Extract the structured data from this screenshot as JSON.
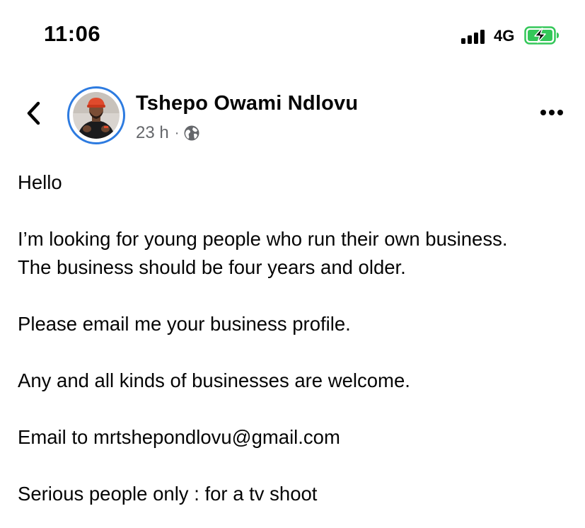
{
  "status_bar": {
    "time": "11:06",
    "network": "4G",
    "signal_bars": 4,
    "battery_charging": true,
    "battery_color": "#34c759"
  },
  "post": {
    "author": "Tshepo Owami Ndlovu",
    "time_ago": "23 h",
    "separator": "·",
    "privacy_icon": "globe-icon",
    "avatar_ring_color": "#2d7be0",
    "body": {
      "line_1": "Hello",
      "line_2": "I’m looking for young people who run their own business.",
      "line_3": "The business should be four years and older.",
      "line_4": "Please email me your business profile.",
      "line_5": "Any and all kinds of businesses are welcome.",
      "line_6_prefix": "Email to ",
      "line_6_email": "mrtshepondlovu@gmail.com",
      "line_7": "Serious people only : for a tv shoot"
    }
  },
  "icons": {
    "back": "chevron-left-icon",
    "more": "more-horizontal-icon"
  }
}
